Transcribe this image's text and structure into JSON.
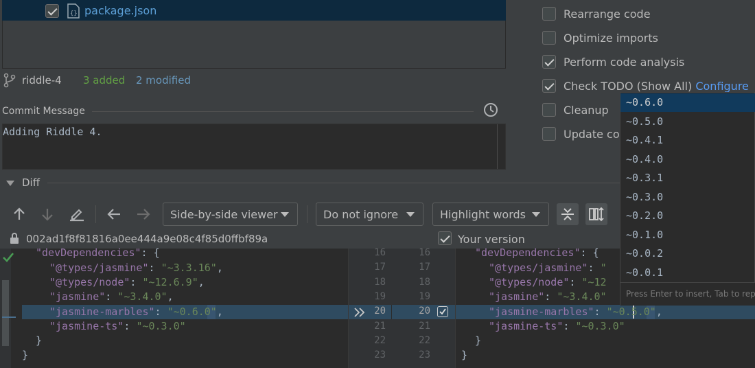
{
  "file_tree": {
    "file_name": "package.json"
  },
  "branch": {
    "name": "riddle-4",
    "added": "3 added",
    "modified": "2 modified"
  },
  "commit": {
    "label": "Commit Message",
    "text": "Adding Riddle 4."
  },
  "options": [
    {
      "label": "Rearrange code",
      "checked": false
    },
    {
      "label": "Optimize imports",
      "checked": false
    },
    {
      "label": "Perform code analysis",
      "checked": true
    },
    {
      "label": "Check TODO (Show All)",
      "link": "Configure",
      "checked": true
    },
    {
      "label": "Cleanup",
      "checked": false
    },
    {
      "label": "Update cop",
      "checked": false
    }
  ],
  "diff": {
    "label": "Diff"
  },
  "toolbar": {
    "viewer": "Side-by-side viewer",
    "ignore": "Do not ignore",
    "highlight": "Highlight words"
  },
  "revision": {
    "hash": "002ad1f8f81816a0ee444a9e08c4f85d0ffbf89a",
    "your_version": "Your version"
  },
  "line_numbers": {
    "left": [
      "16",
      "17",
      "18",
      "19",
      "20",
      "21",
      "22",
      "23"
    ],
    "right": [
      "16",
      "17",
      "18",
      "19",
      "20",
      "21",
      "22",
      "23"
    ]
  },
  "code": {
    "left_changed_value": "\"~0.6.0\"",
    "right_changed_value": "\"~0.5.0\""
  },
  "popup": {
    "items": [
      "~0.6.0",
      "~0.5.0",
      "~0.4.1",
      "~0.4.0",
      "~0.3.1",
      "~0.3.0",
      "~0.2.0",
      "~0.1.0",
      "~0.0.2",
      "~0.0.1"
    ],
    "hint": "Press Enter to insert, Tab to repl"
  },
  "colors": {
    "accent": "#589df6",
    "added": "#62a044",
    "modified": "#6897bb",
    "selection": "#113a5c"
  }
}
